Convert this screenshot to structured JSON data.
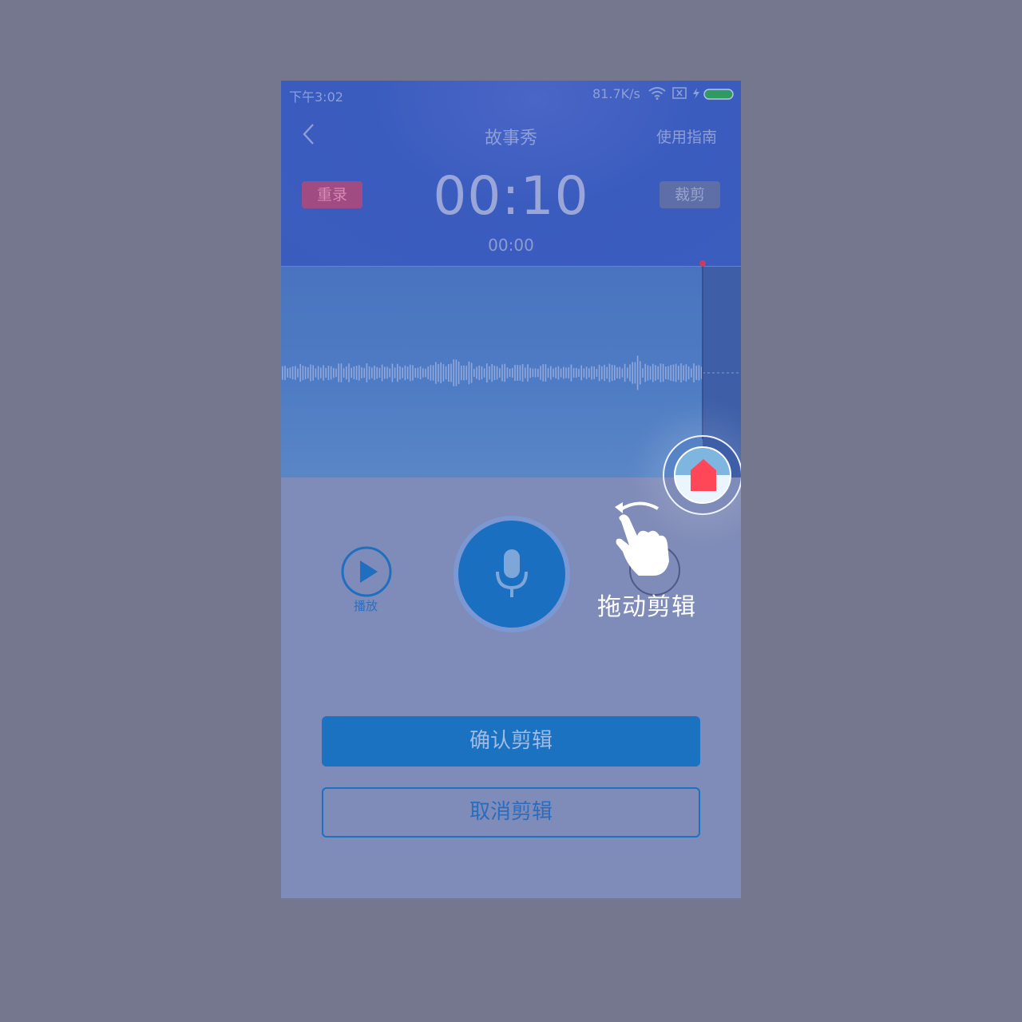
{
  "status_bar": {
    "time": "下午3:02",
    "net_speed": "81.7K/s"
  },
  "header": {
    "title": "故事秀",
    "guide_link": "使用指南",
    "rerecord_label": "重录",
    "cut_label": "裁剪",
    "timer": "00:10",
    "position": "00:00"
  },
  "controls": {
    "play_label": "播放"
  },
  "hint": {
    "text": "拖动剪辑"
  },
  "actions": {
    "confirm_label": "确认剪辑",
    "cancel_label": "取消剪辑"
  },
  "colors": {
    "accent": "#1a72c0",
    "trim_marker": "#ff4757",
    "rerecord": "#a04b82"
  }
}
